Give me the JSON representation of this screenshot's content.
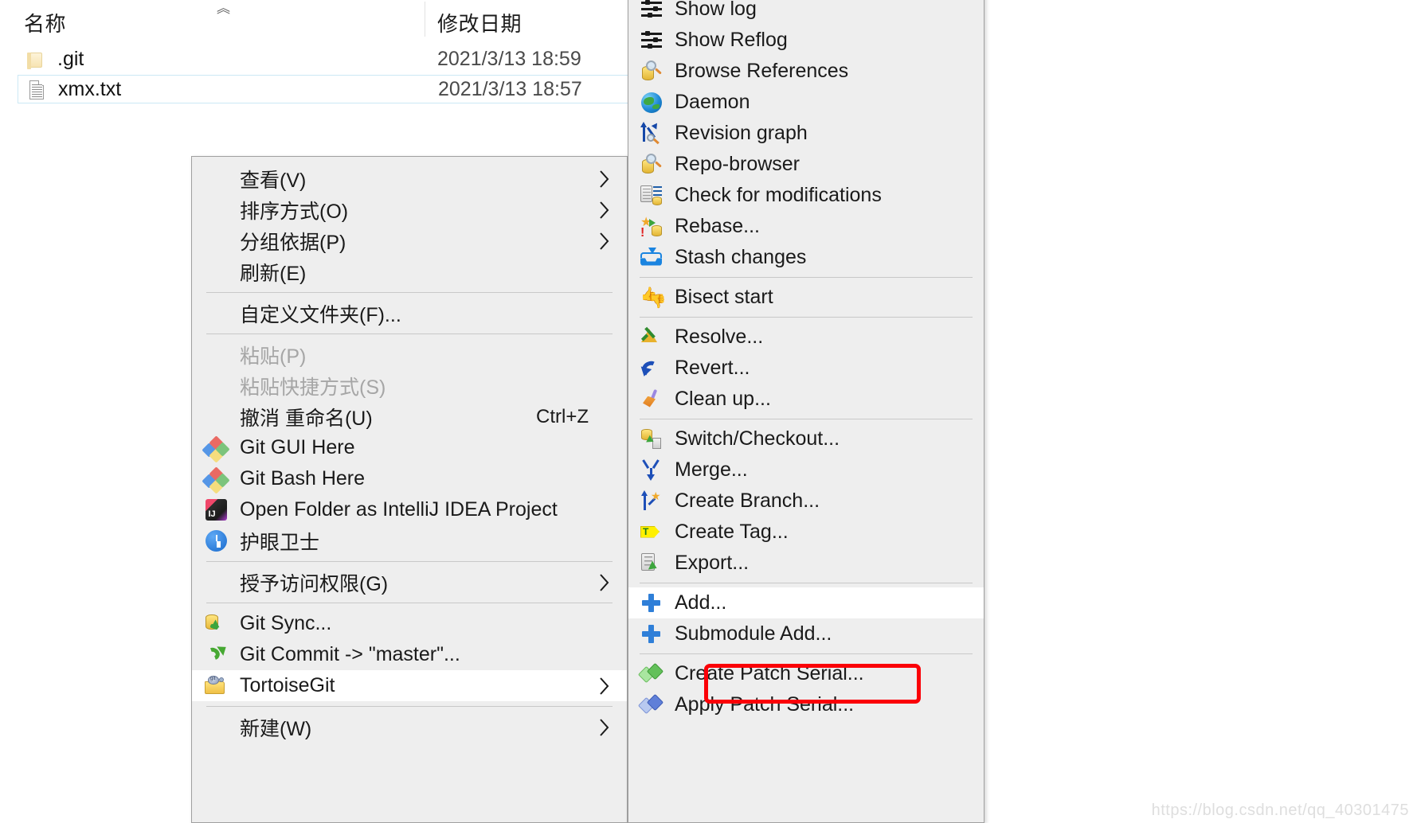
{
  "explorer": {
    "columns": {
      "name": "名称",
      "modified": "修改日期",
      "sort_caret": "︿"
    },
    "rows": [
      {
        "icon": "folder-icon",
        "name": ".git",
        "modified": "2021/3/13 18:59",
        "selected": false
      },
      {
        "icon": "document-icon",
        "name": "xmx.txt",
        "modified": "2021/3/13 18:57",
        "selected": true
      }
    ]
  },
  "context_menu": {
    "items": [
      {
        "label": "查看(V)",
        "icon": null,
        "submenu": true,
        "disabled": false,
        "accel": ""
      },
      {
        "label": "排序方式(O)",
        "icon": null,
        "submenu": true,
        "disabled": false,
        "accel": ""
      },
      {
        "label": "分组依据(P)",
        "icon": null,
        "submenu": true,
        "disabled": false,
        "accel": ""
      },
      {
        "label": "刷新(E)",
        "icon": null,
        "submenu": false,
        "disabled": false,
        "accel": ""
      },
      {
        "separator": true
      },
      {
        "label": "自定义文件夹(F)...",
        "icon": null,
        "submenu": false,
        "disabled": false,
        "accel": ""
      },
      {
        "separator": true
      },
      {
        "label": "粘贴(P)",
        "icon": null,
        "submenu": false,
        "disabled": true,
        "accel": ""
      },
      {
        "label": "粘贴快捷方式(S)",
        "icon": null,
        "submenu": false,
        "disabled": true,
        "accel": ""
      },
      {
        "label": "撤消 重命名(U)",
        "icon": null,
        "submenu": false,
        "disabled": false,
        "accel": "Ctrl+Z"
      },
      {
        "label": "Git GUI Here",
        "icon": "git-logo-icon",
        "submenu": false,
        "disabled": false,
        "accel": ""
      },
      {
        "label": "Git Bash Here",
        "icon": "git-logo-icon",
        "submenu": false,
        "disabled": false,
        "accel": ""
      },
      {
        "label": "Open Folder as IntelliJ IDEA Project",
        "icon": "intellij-idea-icon",
        "submenu": false,
        "disabled": false,
        "accel": ""
      },
      {
        "label": "护眼卫士",
        "icon": "blue-clock-icon",
        "submenu": false,
        "disabled": false,
        "accel": ""
      },
      {
        "separator": true
      },
      {
        "label": "授予访问权限(G)",
        "icon": null,
        "submenu": true,
        "disabled": false,
        "accel": ""
      },
      {
        "separator": true
      },
      {
        "label": "Git Sync...",
        "icon": "git-sync-icon",
        "submenu": false,
        "disabled": false,
        "accel": ""
      },
      {
        "label": "Git Commit -> \"master\"...",
        "icon": "git-commit-icon",
        "submenu": false,
        "disabled": false,
        "accel": ""
      },
      {
        "label": "TortoiseGit",
        "icon": "tortoisegit-icon",
        "submenu": true,
        "disabled": false,
        "accel": "",
        "hovered": true
      },
      {
        "separator": true
      },
      {
        "label": "新建(W)",
        "icon": null,
        "submenu": true,
        "disabled": false,
        "accel": ""
      }
    ]
  },
  "submenu": {
    "items": [
      {
        "label": "Show log",
        "icon": "show-log-icon"
      },
      {
        "label": "Show Reflog",
        "icon": "show-reflog-icon"
      },
      {
        "label": "Browse References",
        "icon": "browse-references-icon"
      },
      {
        "label": "Daemon",
        "icon": "daemon-globe-icon"
      },
      {
        "label": "Revision graph",
        "icon": "revision-graph-icon"
      },
      {
        "label": "Repo-browser",
        "icon": "repo-browser-icon"
      },
      {
        "label": "Check for modifications",
        "icon": "check-modifications-icon"
      },
      {
        "label": "Rebase...",
        "icon": "rebase-icon"
      },
      {
        "label": "Stash changes",
        "icon": "stash-changes-icon"
      },
      {
        "separator": true
      },
      {
        "label": "Bisect start",
        "icon": "bisect-start-icon"
      },
      {
        "separator": true
      },
      {
        "label": "Resolve...",
        "icon": "resolve-icon"
      },
      {
        "label": "Revert...",
        "icon": "revert-icon"
      },
      {
        "label": "Clean up...",
        "icon": "clean-up-broom-icon"
      },
      {
        "separator": true
      },
      {
        "label": "Switch/Checkout...",
        "icon": "switch-checkout-icon"
      },
      {
        "label": "Merge...",
        "icon": "merge-icon"
      },
      {
        "label": "Create Branch...",
        "icon": "create-branch-icon"
      },
      {
        "label": "Create Tag...",
        "icon": "create-tag-icon"
      },
      {
        "label": "Export...",
        "icon": "export-icon"
      },
      {
        "separator": true
      },
      {
        "label": "Add...",
        "icon": "plus-icon",
        "highlighted": true
      },
      {
        "label": "Submodule Add...",
        "icon": "plus-icon"
      },
      {
        "separator": true
      },
      {
        "label": "Create Patch Serial...",
        "icon": "create-patch-serial-icon"
      },
      {
        "label": "Apply Patch Serial...",
        "icon": "apply-patch-serial-icon"
      }
    ]
  },
  "annotation": {
    "highlight_color": "#fb0007",
    "target_label": "Add..."
  },
  "watermark": {
    "text": "https://blog.csdn.net/qq_40301475"
  }
}
